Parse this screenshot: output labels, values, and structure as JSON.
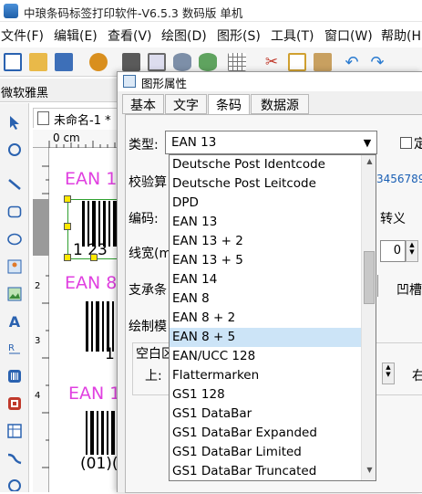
{
  "app": {
    "title": "中琅条码标签打印软件-V6.5.3 数码版 单机"
  },
  "menu": [
    {
      "label": "文件(F)"
    },
    {
      "label": "编辑(E)"
    },
    {
      "label": "查看(V)"
    },
    {
      "label": "绘图(D)"
    },
    {
      "label": "图形(S)"
    },
    {
      "label": "工具(T)"
    },
    {
      "label": "窗口(W)"
    },
    {
      "label": "帮助(H"
    }
  ],
  "toolbar": {
    "icons": [
      "new-icon",
      "open-icon",
      "save-icon",
      "settings-icon",
      "print-icon",
      "print-preview-icon",
      "database-icon",
      "database-settings-icon",
      "grid-icon",
      "cut-icon",
      "copy-icon",
      "paste-icon",
      "undo-icon",
      "redo-icon"
    ]
  },
  "font_row": {
    "font_name": "微软雅黑"
  },
  "toolbox": {
    "tools": [
      "select-arrow-icon",
      "rotate-icon",
      "line-icon",
      "rectangle-icon",
      "ellipse-icon",
      "image-icon",
      "image-icon",
      "text-icon",
      "rich-text-icon",
      "barcode-icon",
      "qrcode-icon",
      "table-icon",
      "curve-icon",
      "more-icon"
    ],
    "text_tool_glyph": "A"
  },
  "document": {
    "tab_label": "未命名-1 *",
    "ruler_label": "0 cm",
    "ruler_left_marks": [
      "1",
      "2",
      "3",
      "4"
    ],
    "barcodes": [
      {
        "label": "EAN 1",
        "digits": "1  23"
      },
      {
        "label": "EAN 8",
        "digits": "1"
      },
      {
        "label": "EAN 1",
        "digits": "(01)("
      }
    ]
  },
  "dialog": {
    "title": "图形属性",
    "tabs": [
      {
        "label": "基本",
        "active": false
      },
      {
        "label": "文字",
        "active": false
      },
      {
        "label": "条码",
        "active": true
      },
      {
        "label": "数据源",
        "active": false
      }
    ],
    "type_label": "类型:",
    "type_value": "EAN 13",
    "fixed_checkbox_label": "定",
    "labels": {
      "checksum": "校验算",
      "encoding": "编码:",
      "line_width": "线宽(m",
      "supported": "支承条",
      "draw_mode": "绘制模",
      "blank_area": "空白区",
      "top": "上:"
    },
    "right_values": {
      "sample_digits": "3456789",
      "escape": "转义",
      "line_width_value": "0",
      "groove": "凹槽",
      "right": "右"
    },
    "dropdown_options": [
      "Deutsche Post Identcode",
      "Deutsche Post Leitcode",
      "DPD",
      "EAN 13",
      "EAN 13 + 2",
      "EAN 13 + 5",
      "EAN 14",
      "EAN 8",
      "EAN 8 + 2",
      "EAN 8 + 5",
      "EAN/UCC 128",
      "Flattermarken",
      "GS1 128",
      "GS1 DataBar",
      "GS1 DataBar Expanded",
      "GS1 DataBar Limited",
      "GS1 DataBar Truncated"
    ],
    "dropdown_selected": "EAN 8 + 5"
  },
  "colors": {
    "barcode_label": "#e040e0",
    "selection_highlight": "#cce4f7",
    "dialog_background": "#f0f0f0",
    "link_blue": "#1a5fb4"
  }
}
